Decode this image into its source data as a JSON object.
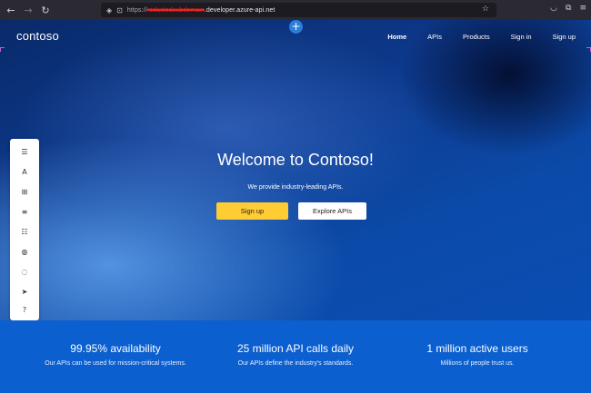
{
  "browser": {
    "back_icon": "arrow-left-icon",
    "forward_icon": "arrow-right-icon",
    "reload_icon": "reload-icon",
    "url_prefix": "https://",
    "url_redacted": "redactedsubdomain",
    "url_host": ".developer.azure-api.net"
  },
  "site": {
    "brand": "contoso",
    "nav": [
      "Home",
      "APIs",
      "Products",
      "Sign in",
      "Sign up"
    ]
  },
  "hero": {
    "title": "Welcome to Contoso!",
    "subtitle": "We provide industry-leading APIs.",
    "primary_button": "Sign up",
    "secondary_button": "Explore APIs"
  },
  "stats": [
    {
      "headline": "99.95% availability",
      "caption": "Our APIs can be used for mission-critical systems."
    },
    {
      "headline": "25 million API calls daily",
      "caption": "Our APIs define the industry's standards."
    },
    {
      "headline": "1 million active users",
      "caption": "Millions of people trust us."
    }
  ],
  "editor_toolbar": [
    "text-icon",
    "typography-icon",
    "widgets-icon",
    "layout-icon",
    "settings-icon",
    "styles-icon",
    "comment-icon",
    "publish-icon",
    "help-icon"
  ],
  "colors": {
    "accent_yellow": "#ffcc33",
    "stats_band": "#0b5fcf",
    "add_button": "#2a7fd9"
  }
}
